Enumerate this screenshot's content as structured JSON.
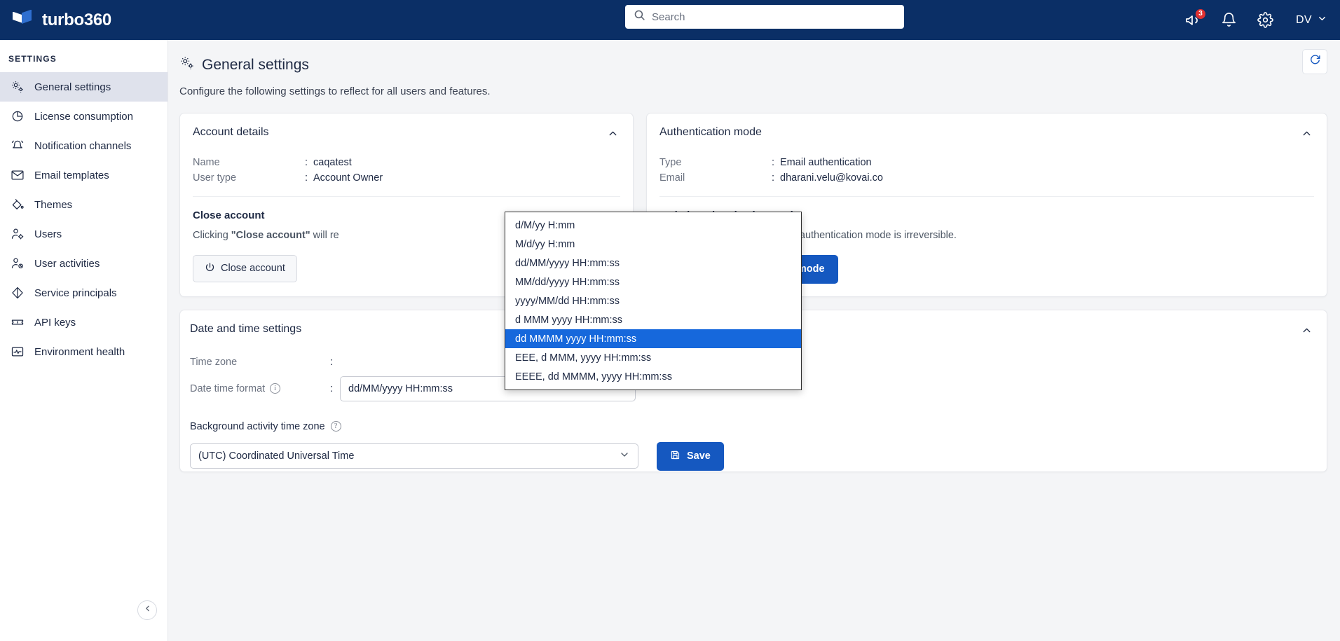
{
  "app": {
    "brand": "turbo360",
    "logo_icon": "turbo360-logo-icon"
  },
  "search": {
    "placeholder": "Search",
    "value": "",
    "icon": "search-icon"
  },
  "header_icons": {
    "announcement": {
      "icon": "megaphone-icon",
      "badge": "3"
    },
    "notifications": {
      "icon": "bell-icon"
    },
    "settings": {
      "icon": "gear-icon"
    },
    "user": {
      "initials": "DV",
      "chevron": "chevron-down-icon"
    }
  },
  "sidebar": {
    "title": "SETTINGS",
    "collapse_icon": "chevron-left-icon",
    "items": [
      {
        "label": "General settings",
        "icon": "gears-icon",
        "active": true
      },
      {
        "label": "License consumption",
        "icon": "pie-chart-icon",
        "active": false
      },
      {
        "label": "Notification channels",
        "icon": "bell-ring-icon",
        "active": false
      },
      {
        "label": "Email templates",
        "icon": "envelope-icon",
        "active": false
      },
      {
        "label": "Themes",
        "icon": "paint-bucket-icon",
        "active": false
      },
      {
        "label": "Users",
        "icon": "user-gear-icon",
        "active": false
      },
      {
        "label": "User activities",
        "icon": "user-clock-icon",
        "active": false
      },
      {
        "label": "Service principals",
        "icon": "diamond-icon",
        "active": false
      },
      {
        "label": "API keys",
        "icon": "ticket-icon",
        "active": false
      },
      {
        "label": "Environment health",
        "icon": "pulse-icon",
        "active": false
      }
    ]
  },
  "page": {
    "title": "General settings",
    "title_icon": "gears-icon",
    "subtitle": "Configure the following settings to reflect for all users and features.",
    "refresh_icon": "refresh-icon"
  },
  "account_details": {
    "title": "Account details",
    "collapse_icon": "chevron-up-icon",
    "fields": [
      {
        "label": "Name",
        "sep": ":",
        "value": "caqatest"
      },
      {
        "label": "User type",
        "sep": ":",
        "value": "Account Owner"
      }
    ],
    "close_account": {
      "heading": "Close account",
      "description": "Clicking \"Close account\" will re",
      "button_label": "Close account",
      "button_icon": "power-icon"
    }
  },
  "authentication_mode": {
    "title": "Authentication mode",
    "collapse_icon": "chevron-up-icon",
    "fields": [
      {
        "label": "Type",
        "sep": ":",
        "value": "Email authentication"
      },
      {
        "label": "Email",
        "sep": ":",
        "value": "dharani.velu@kovai.co"
      }
    ],
    "switch": {
      "heading": "Switch authentication mode",
      "description": "This operation of switching the authentication mode is irreversible.",
      "button_label": "Switch authentication mode",
      "button_icon": "switch-icon"
    }
  },
  "date_time_settings": {
    "title": "Date and time settings",
    "collapse_icon": "chevron-up-icon",
    "time_zone": {
      "label": "Time zone",
      "sep": ":"
    },
    "date_time_format": {
      "label": "Date time format",
      "sep": ":",
      "info_icon": "info-icon",
      "value": "dd/MM/yyyy HH:mm:ss",
      "chevron": "chevron-down-icon"
    },
    "background_tz": {
      "label": "Background activity time zone",
      "help_icon": "help-circle-icon",
      "value": "(UTC) Coordinated Universal Time",
      "chevron": "chevron-down-icon"
    },
    "save": {
      "label": "Save",
      "icon": "save-icon"
    }
  },
  "dropdown": {
    "open": true,
    "selected_index": 6,
    "options": [
      "d/M/yy H:mm",
      "M/d/yy H:mm",
      "dd/MM/yyyy HH:mm:ss",
      "MM/dd/yyyy HH:mm:ss",
      "yyyy/MM/dd HH:mm:ss",
      "d MMM yyyy HH:mm:ss",
      "dd MMMM yyyy HH:mm:ss",
      "EEE, d MMM, yyyy HH:mm:ss",
      "EEEE, dd MMMM, yyyy HH:mm:ss"
    ]
  },
  "colors": {
    "topbar": "#0b2f66",
    "accent": "#1558c0",
    "highlight": "#1668dc",
    "sidebar_active": "#dfe2ec",
    "page_bg": "#f4f5f7",
    "badge": "#e03131"
  }
}
